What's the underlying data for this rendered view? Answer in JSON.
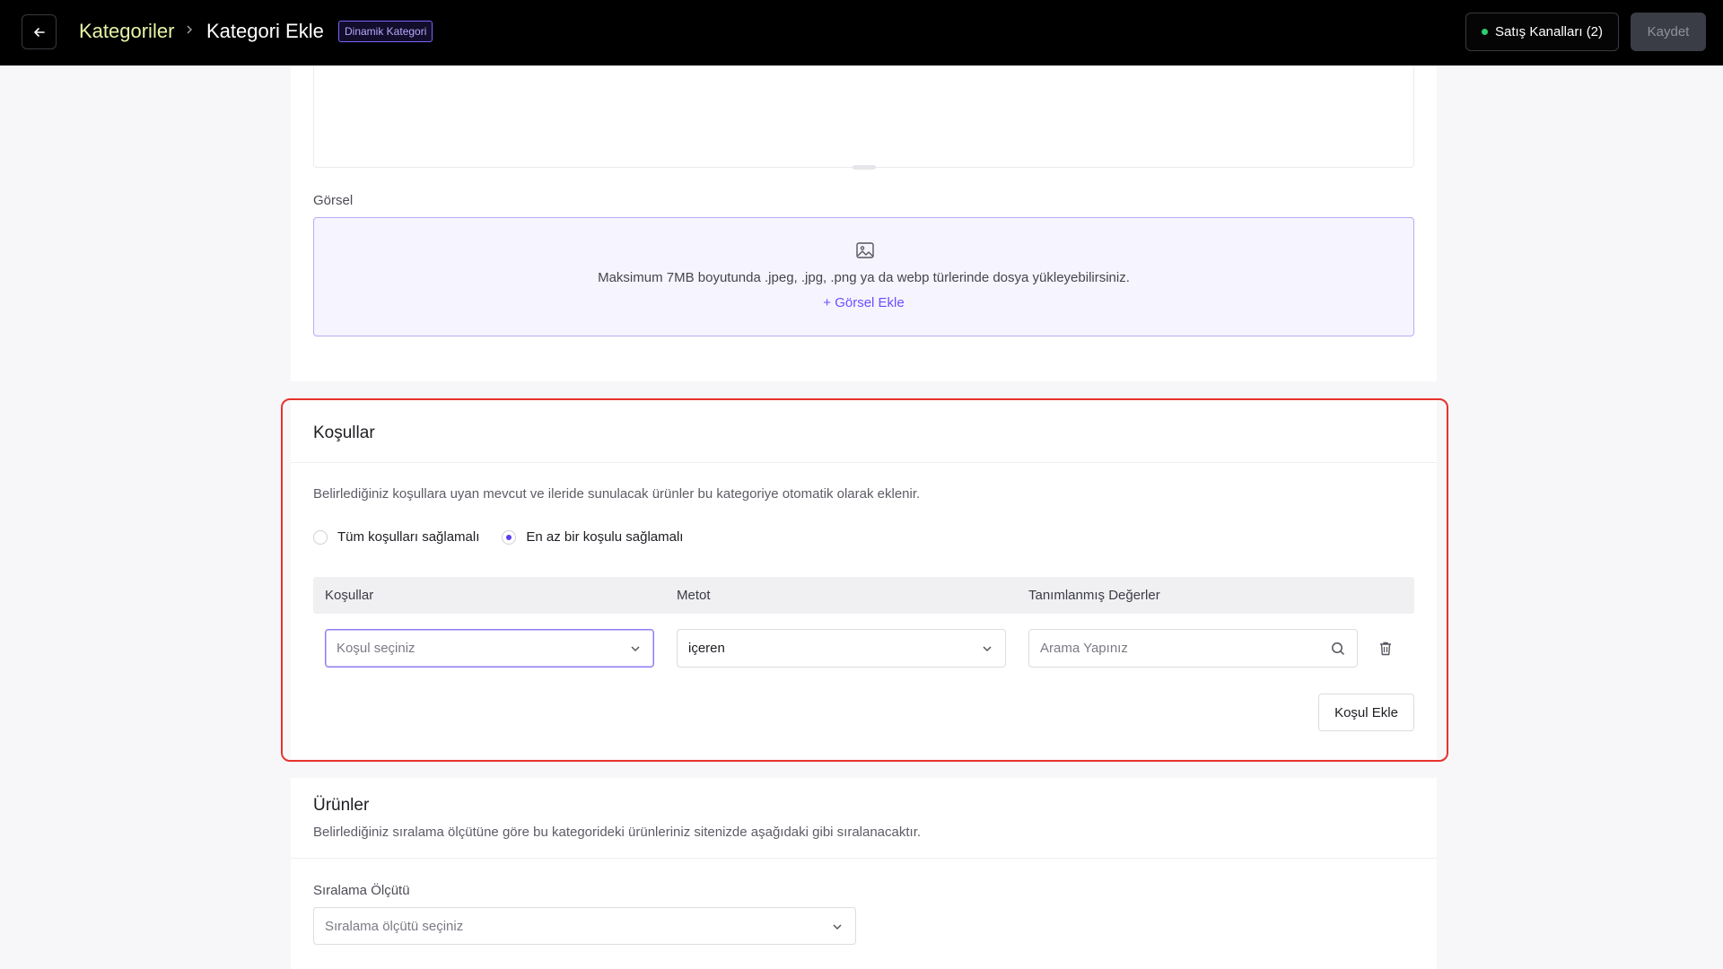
{
  "header": {
    "breadcrumb_root": "Kategoriler",
    "breadcrumb_separator": ">",
    "breadcrumb_current": "Kategori Ekle",
    "badge": "Dinamik Kategori",
    "channels_label": "Satış Kanalları (2)",
    "save_label": "Kaydet"
  },
  "image_section": {
    "label": "Görsel",
    "hint": "Maksimum 7MB boyutunda .jpeg, .jpg, .png ya da webp türlerinde dosya yükleyebilirsiniz.",
    "add_label": "+ Görsel Ekle"
  },
  "conditions": {
    "title": "Koşullar",
    "description": "Belirlediğiniz koşullara uyan mevcut ve ileride sunulacak ürünler bu kategoriye otomatik olarak eklenir.",
    "options": [
      {
        "label": "Tüm koşulları sağlamalı",
        "selected": false
      },
      {
        "label": "En az bir koşulu sağlamalı",
        "selected": true
      }
    ],
    "columns": [
      "Koşullar",
      "Metot",
      "Tanımlanmış Değerler"
    ],
    "row": {
      "condition_placeholder": "Koşul seçiniz",
      "method_value": "içeren",
      "values_placeholder": "Arama Yapınız"
    },
    "add_label": "Koşul Ekle"
  },
  "products": {
    "title": "Ürünler",
    "description": "Belirlediğiniz sıralama ölçütüne göre bu kategorideki ürünleriniz sitenizde aşağıdaki gibi sıralanacaktır.",
    "sort_label": "Sıralama Ölçütü",
    "sort_placeholder": "Sıralama ölçütü seçiniz"
  },
  "colors": {
    "accent": "#6b4eff",
    "highlight": "#e8322c",
    "breadcrumb": "#e9f5a6",
    "status_dot": "#2ecc71"
  }
}
